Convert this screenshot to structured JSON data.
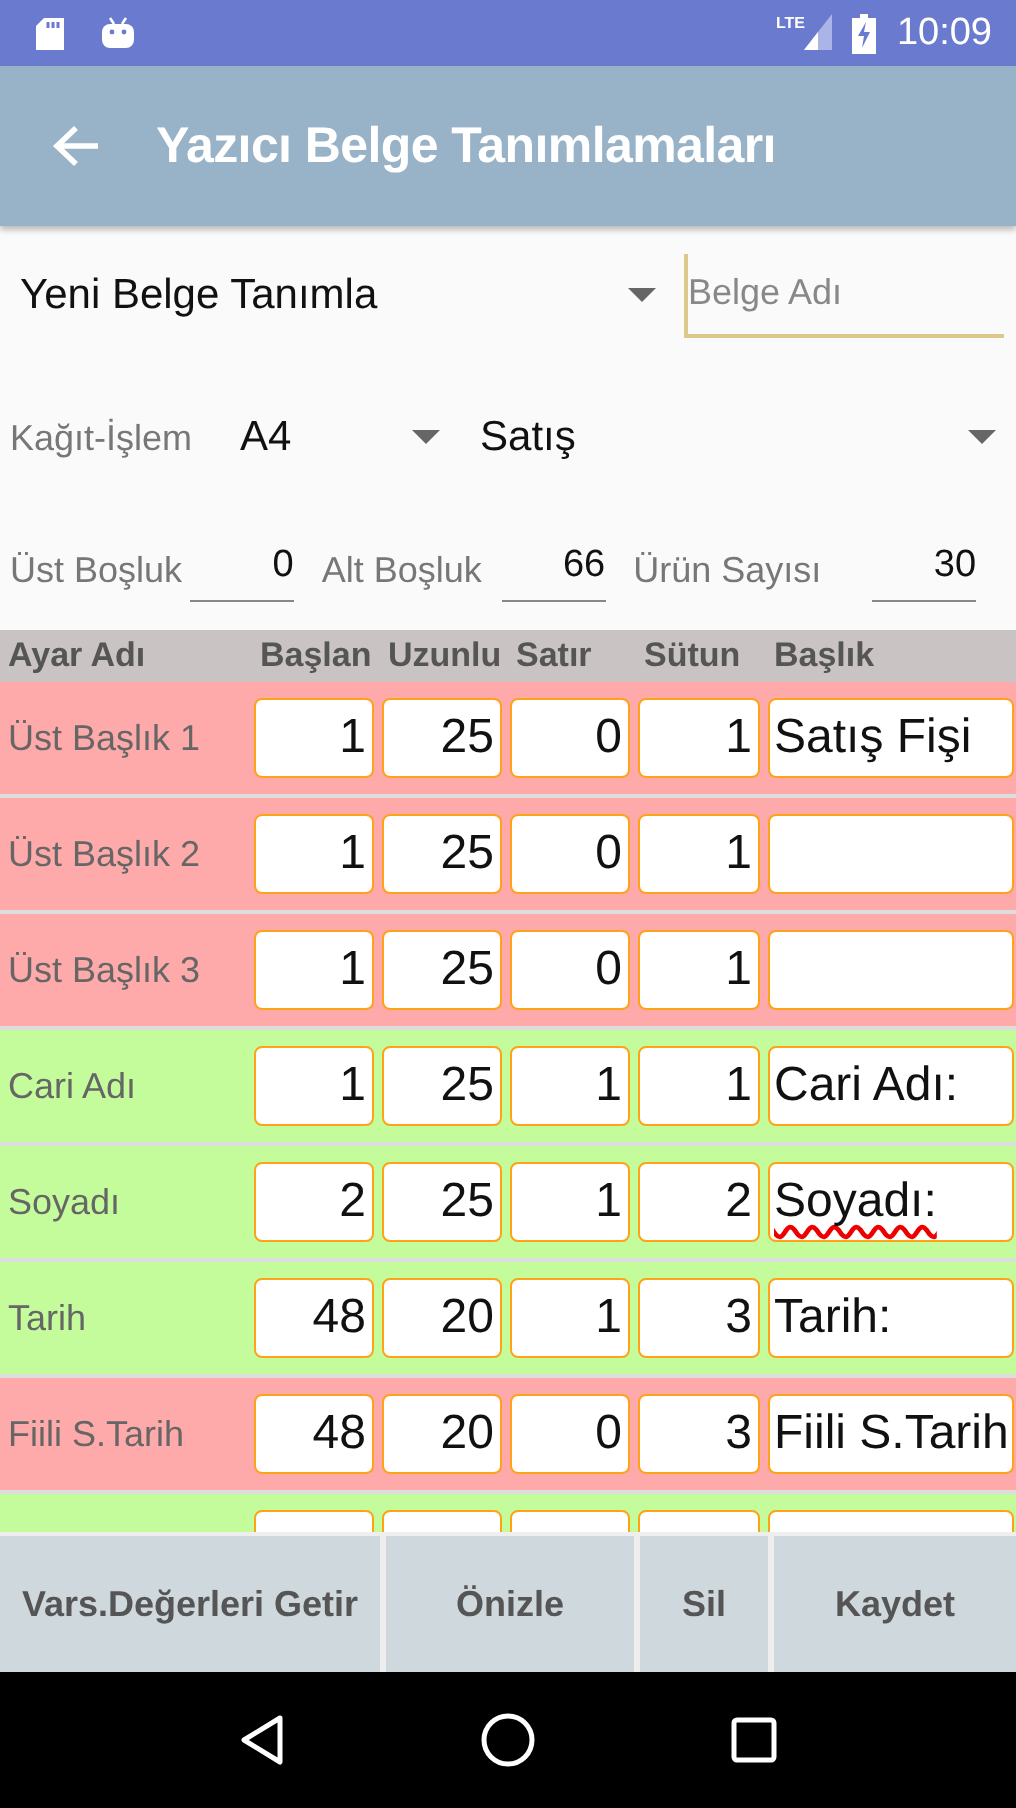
{
  "status_bar": {
    "network": "LTE",
    "time": "10:09"
  },
  "app_bar": {
    "title": "Yazıcı Belge Tanımlamaları"
  },
  "document_spinner": {
    "value": "Yeni Belge Tanımla"
  },
  "document_name": {
    "placeholder": "Belge Adı"
  },
  "paper_label": "Kağıt-İşlem",
  "paper_spinner": {
    "value": "A4"
  },
  "operation_spinner": {
    "value": "Satış"
  },
  "margins": [
    {
      "label": "Üst Boşluk",
      "value": "0"
    },
    {
      "label": "Alt Boşluk",
      "value": "66"
    },
    {
      "label": "Ürün Sayısı",
      "value": "30"
    }
  ],
  "table": {
    "columns": [
      "Ayar Adı",
      "Başlan",
      "Uzunlu",
      "Satır",
      "Sütun",
      "Başlık"
    ],
    "rows": [
      {
        "name": "Üst Başlık 1",
        "color": "#ffaaaa",
        "values": [
          "1",
          "25",
          "0",
          "1"
        ],
        "title": "Satış Fişi",
        "misspelled": false
      },
      {
        "name": "Üst Başlık 2",
        "color": "#ffaaaa",
        "values": [
          "1",
          "25",
          "0",
          "1"
        ]
      },
      {
        "name": "Üst Başlık 3",
        "color": "#ffaaaa",
        "values": [
          "1",
          "25",
          "0",
          "1"
        ]
      },
      {
        "name": "Cari Adı",
        "color": "#c4fc9c",
        "values": [
          "1",
          "25",
          "1",
          "1"
        ],
        "title": "Cari Adı:",
        "misspelled": false
      },
      {
        "name": "Soyadı",
        "color": "#c4fc9c",
        "values": [
          "2",
          "25",
          "1",
          "2"
        ],
        "title": "Soyadı:",
        "misspelled": true
      },
      {
        "name": "Tarih",
        "color": "#c4fc9c",
        "values": [
          "48",
          "20",
          "1",
          "3"
        ],
        "title": "Tarih:",
        "misspelled": false
      },
      {
        "name": "Fiili S.Tarih",
        "color": "#ffaaaa",
        "values": [
          "48",
          "20",
          "0",
          "3"
        ],
        "title": "Fiili S.Tarih",
        "misspelled": false
      },
      {
        "color": "#c4fc9c"
      }
    ]
  },
  "buttons": [
    "Vars.Değerleri Getir",
    "Önizle",
    "Sil",
    "Kaydet"
  ]
}
